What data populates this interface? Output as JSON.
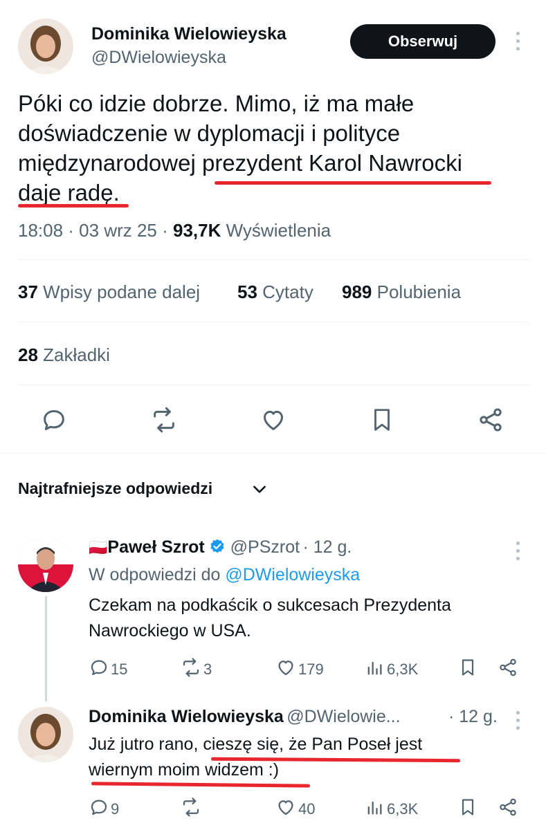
{
  "main_tweet": {
    "author_name": "Dominika Wielowieyska",
    "author_handle": "@DWielowieyska",
    "follow_label": "Obserwuj",
    "text_line1": "Póki co idzie dobrze. Mimo, iż ma małe",
    "text_line2": "doświadczenie w dyplomacji i polityce",
    "text_line3a": "międzynarodowej ",
    "text_line3b": "prezydent Karol Nawrocki",
    "text_line4": "daje radę.",
    "time": "18:08 · 03 wrz 25 · ",
    "views_count": "93,7K",
    "views_label": " Wyświetlenia",
    "reposts_count": "37",
    "reposts_label": " Wpisy podane dalej",
    "quotes_count": "53",
    "quotes_label": " Cytaty",
    "likes_count": "989",
    "likes_label": " Polubienia",
    "bookmarks_count": "28",
    "bookmarks_label": " Zakładki"
  },
  "replies_section": {
    "title": "Najtrafniejsze odpowiedzi"
  },
  "reply1": {
    "flag": "🇵🇱",
    "author_name": "Paweł Szrot",
    "author_handle": "@PSzrot",
    "time": "· 12 g.",
    "replying_prefix": "W odpowiedzi do ",
    "replying_handle": "@DWielowieyska",
    "text_line1": "Czekam na podkaścik o sukcesach Prezydenta",
    "text_line2": "Nawrockiego w USA.",
    "replies": "15",
    "reposts": "3",
    "likes": "179",
    "views": "6,3K"
  },
  "reply2": {
    "author_name": "Dominika Wielowieyska",
    "author_handle": "@DWielowie...",
    "time": "· 12 g.",
    "text_line1a": "Już jutro rano, ",
    "text_line1b": "cieszę się, że Pan Poseł jest",
    "text_line2": "wiernym moim widzem :)",
    "replies": "9",
    "reposts": "",
    "likes": "40",
    "views": "6,3K"
  },
  "colors": {
    "text": "#0f1419",
    "secondary": "#536471",
    "link": "#1d9bf0",
    "verified": "#1d9bf0",
    "underline_annotation": "#e8262d"
  }
}
